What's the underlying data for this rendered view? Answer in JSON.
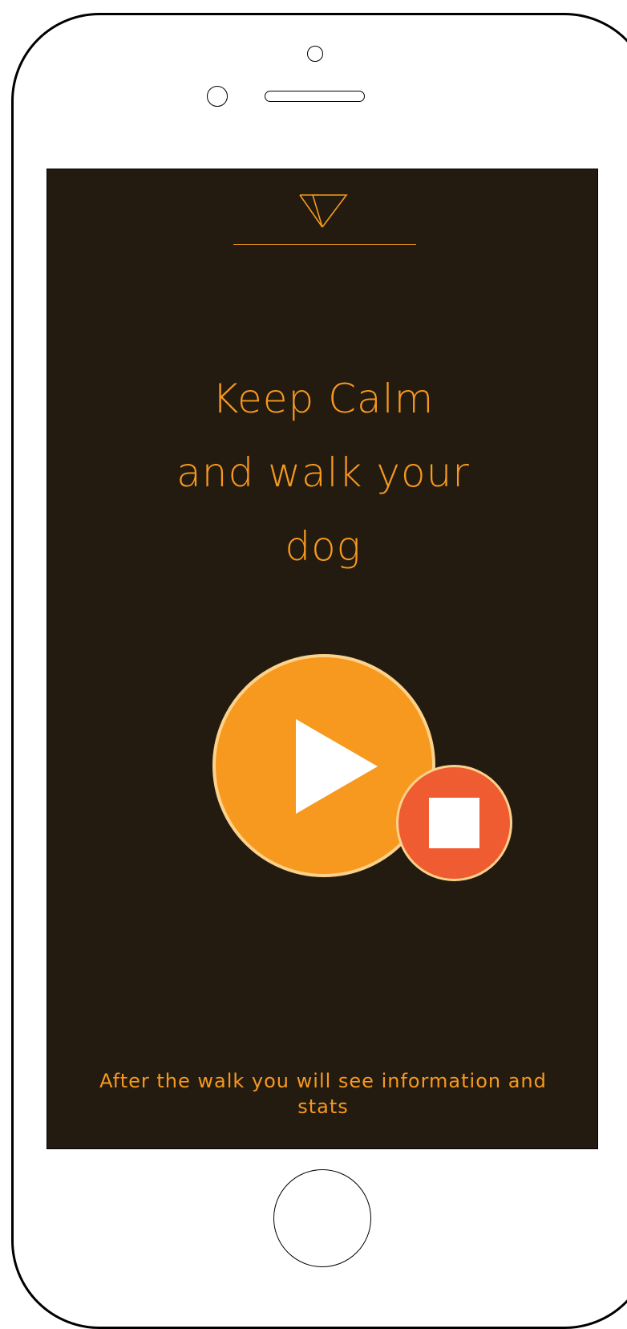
{
  "app": {
    "headline_line1": "Keep Calm",
    "headline_line2": "and walk your",
    "headline_line3": "dog",
    "footer": "After the walk you will see information and stats"
  },
  "icons": {
    "logo": "double-triangle-logo-icon",
    "play": "play-icon",
    "stop": "stop-icon"
  },
  "colors": {
    "background": "#241b10",
    "accent": "#f7991f",
    "stop": "#f05c32",
    "ring": "#fbd28b"
  }
}
